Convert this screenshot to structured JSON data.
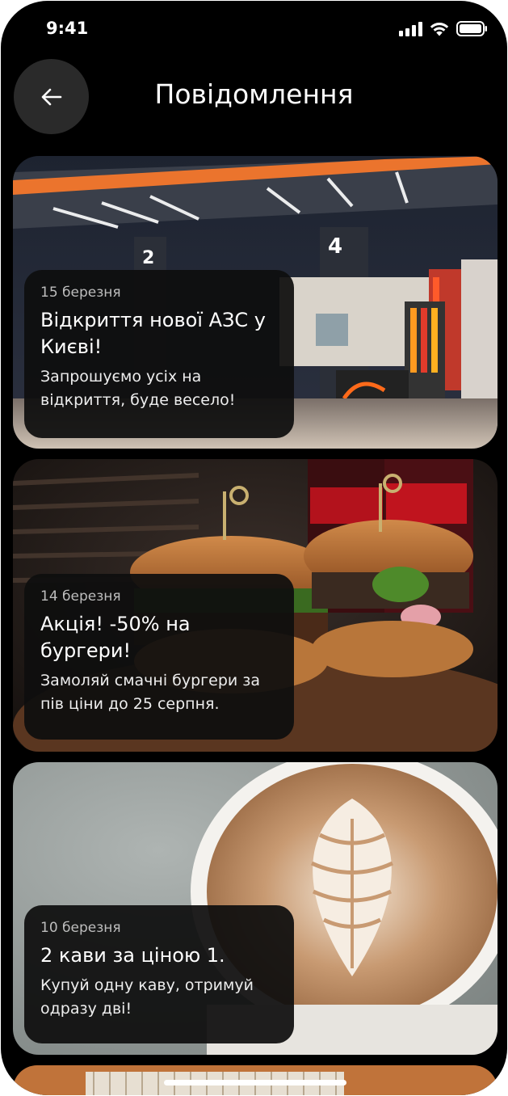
{
  "status_bar": {
    "time": "9:41"
  },
  "header": {
    "title": "Повідомлення"
  },
  "notifications": [
    {
      "date": "15 березня",
      "title": "Відкриття нової АЗС у Києві!",
      "text": "Запрошуємо усіх на відкриття, буде весело!",
      "image": "gas-station-photo"
    },
    {
      "date": "14 березня",
      "title": "Акція! -50% на бургери!",
      "text": "Замоляй смачні бургери за пів ціни до 25 серпня.",
      "image": "burgers-photo"
    },
    {
      "date": "10 березня",
      "title": "2 кави за ціною 1.",
      "text": "Купуй одну каву, отримуй одразу дві!",
      "image": "coffee-photo"
    }
  ],
  "colors": {
    "background": "#000000",
    "overlay": "#0e0e0e",
    "back_button": "#2a2a2a",
    "text": "#ffffff",
    "date_text": "#bdbdbd"
  }
}
